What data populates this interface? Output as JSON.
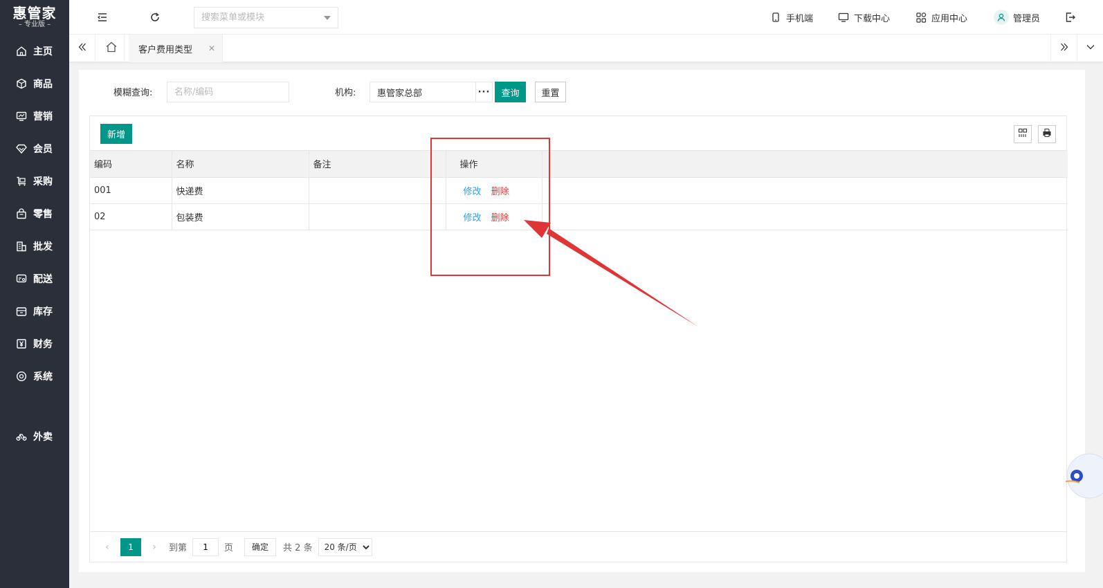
{
  "logo": {
    "main": "惠管家",
    "sub": "– 专业版 –"
  },
  "sidebar": {
    "items": [
      {
        "label": "主页",
        "icon": "home-icon"
      },
      {
        "label": "商品",
        "icon": "box-icon"
      },
      {
        "label": "营销",
        "icon": "chart-icon"
      },
      {
        "label": "会员",
        "icon": "diamond-icon"
      },
      {
        "label": "采购",
        "icon": "cart-icon"
      },
      {
        "label": "零售",
        "icon": "bag-icon"
      },
      {
        "label": "批发",
        "icon": "building-icon"
      },
      {
        "label": "配送",
        "icon": "truck-icon"
      },
      {
        "label": "库存",
        "icon": "warehouse-icon"
      },
      {
        "label": "财务",
        "icon": "yen-icon"
      },
      {
        "label": "系统",
        "icon": "gear-icon"
      }
    ],
    "extra": {
      "label": "外卖",
      "icon": "bike-icon"
    }
  },
  "topbar": {
    "search_placeholder": "搜索菜单或模块",
    "mobile": "手机端",
    "download": "下载中心",
    "apps": "应用中心",
    "user": "管理员"
  },
  "tabs": {
    "active": "客户费用类型"
  },
  "filter": {
    "fuzzy_label": "模糊查询:",
    "fuzzy_placeholder": "名称/编码",
    "org_label": "机构:",
    "org_value": "惠管家总部",
    "org_more": "···",
    "query": "查询",
    "reset": "重置"
  },
  "toolbar": {
    "add": "新增"
  },
  "table": {
    "headers": [
      "编码",
      "名称",
      "备注",
      "操作"
    ],
    "rows": [
      {
        "code": "001",
        "name": "快递费",
        "note": "",
        "edit": "修改",
        "del": "删除"
      },
      {
        "code": "02",
        "name": "包装费",
        "note": "",
        "edit": "修改",
        "del": "删除"
      }
    ]
  },
  "pager": {
    "current": "1",
    "goto": "到第",
    "page_value": "1",
    "page_unit": "页",
    "confirm": "确定",
    "total": "共 2 条",
    "size": "20 条/页"
  },
  "colors": {
    "primary": "#009688",
    "link": "#1e9fff",
    "danger": "#ff2e2e",
    "annotation": "#e03535",
    "sidebar": "#2b2f3a"
  }
}
